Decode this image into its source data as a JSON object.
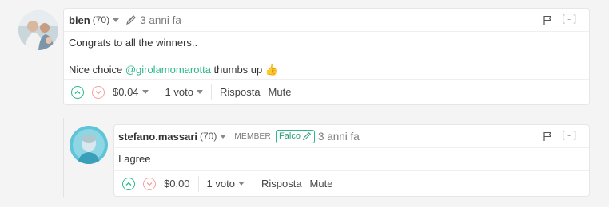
{
  "comments": [
    {
      "author": "bien",
      "reputation": "(70)",
      "time": "3 anni fa",
      "collapse": "[-]",
      "lines": [
        "Congrats to all the winners..",
        "Nice choice "
      ],
      "mention": "@girolamomarotta",
      "line2_suffix": " thumbs up",
      "emoji": "👍",
      "payout": "$0.04",
      "votes": "1 voto",
      "reply": "Risposta",
      "mute": "Mute"
    },
    {
      "author": "stefano.massari",
      "reputation": "(70)",
      "role": "MEMBER",
      "badge": "Falco",
      "time": "3 anni fa",
      "collapse": "[-]",
      "text": "I agree",
      "payout": "$0.00",
      "votes": "1 voto",
      "reply": "Risposta",
      "mute": "Mute"
    }
  ],
  "colors": {
    "accent": "#2bb88a",
    "downvote": "#f1a3a3"
  },
  "icons": [
    "pencil-icon",
    "flag-icon",
    "upvote-icon",
    "downvote-icon",
    "chevron-down-icon"
  ]
}
